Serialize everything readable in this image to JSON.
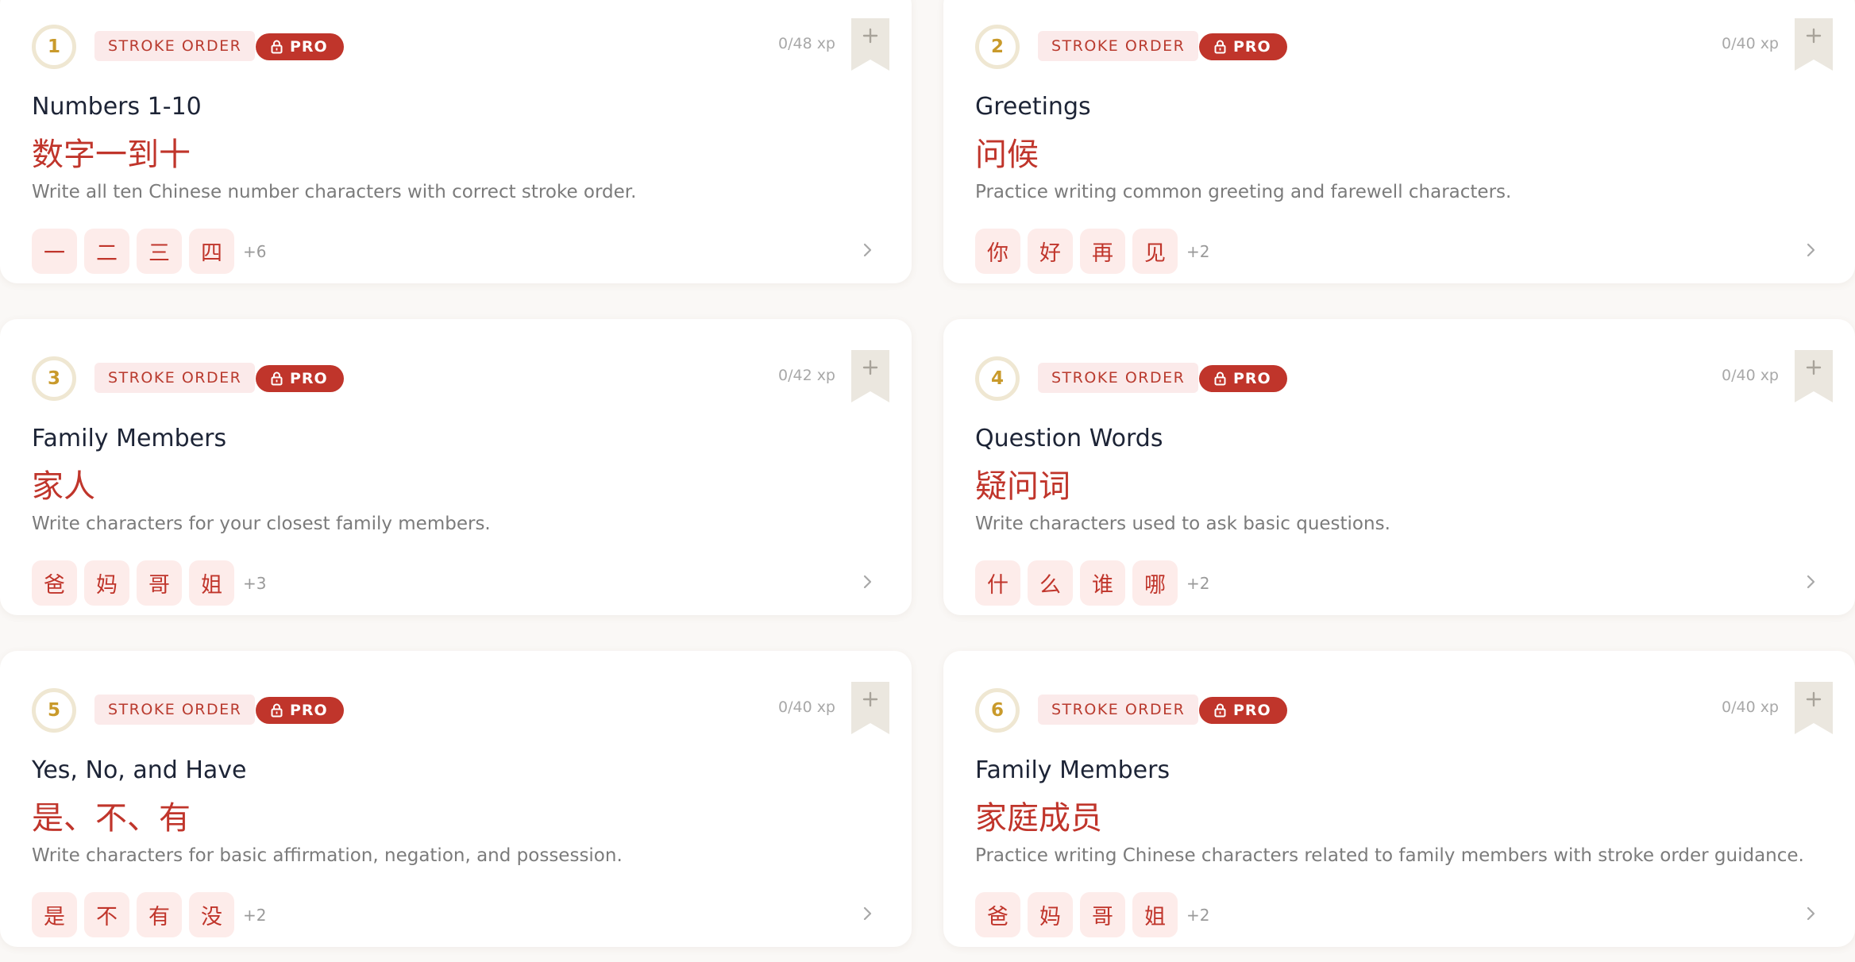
{
  "lessons": [
    {
      "number": "1",
      "tag": "STROKE ORDER",
      "badge": "PRO",
      "xp": "0/48 xp",
      "title": "Numbers 1-10",
      "hanzi": "数字一到十",
      "description": "Write all ten Chinese number characters with correct stroke order.",
      "chars": [
        "一",
        "二",
        "三",
        "四"
      ],
      "more": "+6"
    },
    {
      "number": "2",
      "tag": "STROKE ORDER",
      "badge": "PRO",
      "xp": "0/40 xp",
      "title": "Greetings",
      "hanzi": "问候",
      "description": "Practice writing common greeting and farewell characters.",
      "chars": [
        "你",
        "好",
        "再",
        "见"
      ],
      "more": "+2"
    },
    {
      "number": "3",
      "tag": "STROKE ORDER",
      "badge": "PRO",
      "xp": "0/42 xp",
      "title": "Family Members",
      "hanzi": "家人",
      "description": "Write characters for your closest family members.",
      "chars": [
        "爸",
        "妈",
        "哥",
        "姐"
      ],
      "more": "+3"
    },
    {
      "number": "4",
      "tag": "STROKE ORDER",
      "badge": "PRO",
      "xp": "0/40 xp",
      "title": "Question Words",
      "hanzi": "疑问词",
      "description": "Write characters used to ask basic questions.",
      "chars": [
        "什",
        "么",
        "谁",
        "哪"
      ],
      "more": "+2"
    },
    {
      "number": "5",
      "tag": "STROKE ORDER",
      "badge": "PRO",
      "xp": "0/40 xp",
      "title": "Yes, No, and Have",
      "hanzi": "是、不、有",
      "description": "Write characters for basic affirmation, negation, and possession.",
      "chars": [
        "是",
        "不",
        "有",
        "没"
      ],
      "more": "+2"
    },
    {
      "number": "6",
      "tag": "STROKE ORDER",
      "badge": "PRO",
      "xp": "0/40 xp",
      "title": "Family Members",
      "hanzi": "家庭成员",
      "description": "Practice writing Chinese characters related to family members with stroke order guidance.",
      "chars": [
        "爸",
        "妈",
        "哥",
        "姐"
      ],
      "more": "+2"
    }
  ],
  "colors": {
    "accent": "#c0352b",
    "number_ring": "#efe7d2",
    "number_text": "#c99a2b",
    "chip_bg": "#fdecea",
    "title_text": "#1d2436"
  }
}
